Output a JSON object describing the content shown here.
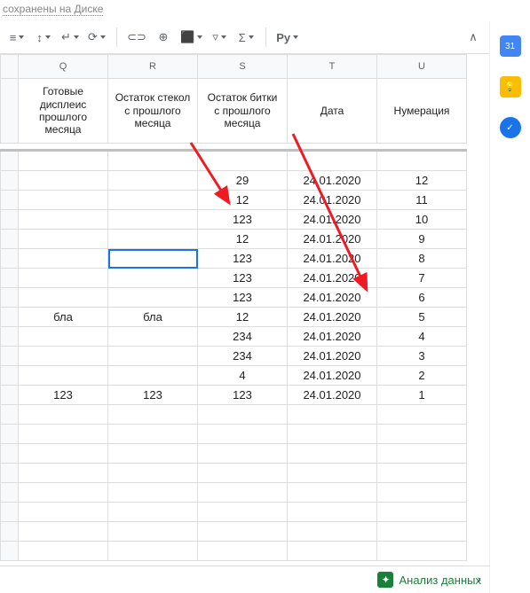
{
  "top_status": "сохранены на Диске",
  "toolbar": {
    "link": "⊂⊃",
    "comment": "⊕",
    "chart": "⬛",
    "filter": "▿",
    "sigma": "Σ",
    "py": "Py"
  },
  "side_rail": {
    "cal": "31",
    "keep": "",
    "tasks": "✓"
  },
  "columns": [
    {
      "id": "Q",
      "letter": "Q",
      "header": "Готовые дисплеис прошлого месяца"
    },
    {
      "id": "R",
      "letter": "R",
      "header": "Остаток стекол с прошлого месяца"
    },
    {
      "id": "S",
      "letter": "S",
      "header": "Остаток битки с прошлого месяца"
    },
    {
      "id": "T",
      "letter": "T",
      "header": "Дата"
    },
    {
      "id": "U",
      "letter": "U",
      "header": "Нумерация"
    }
  ],
  "rows": [
    {
      "Q": "",
      "R": "",
      "S": "29",
      "T": "24.01.2020",
      "U": "12"
    },
    {
      "Q": "",
      "R": "",
      "S": "12",
      "T": "24.01.2020",
      "U": "11"
    },
    {
      "Q": "",
      "R": "",
      "S": "123",
      "T": "24.01.2020",
      "U": "10"
    },
    {
      "Q": "",
      "R": "",
      "S": "12",
      "T": "24.01.2020",
      "U": "9"
    },
    {
      "Q": "",
      "R": "",
      "S": "123",
      "T": "24.01.2020",
      "U": "8"
    },
    {
      "Q": "",
      "R": "",
      "S": "123",
      "T": "24.01.2020",
      "U": "7"
    },
    {
      "Q": "",
      "R": "",
      "S": "123",
      "T": "24.01.2020",
      "U": "6"
    },
    {
      "Q": "бла",
      "R": "бла",
      "S": "12",
      "T": "24.01.2020",
      "U": "5"
    },
    {
      "Q": "",
      "R": "",
      "S": "234",
      "T": "24.01.2020",
      "U": "4"
    },
    {
      "Q": "",
      "R": "",
      "S": "234",
      "T": "24.01.2020",
      "U": "3"
    },
    {
      "Q": "",
      "R": "",
      "S": "4",
      "T": "24.01.2020",
      "U": "2"
    },
    {
      "Q": "123",
      "R": "123",
      "S": "123",
      "T": "24.01.2020",
      "U": "1"
    }
  ],
  "selected_cell": {
    "row": 4,
    "col": "R"
  },
  "bottom": {
    "analyze": "Анализ данных"
  },
  "chart_data": {
    "type": "table",
    "title": "",
    "columns": [
      "Готовые дисплеис прошлого месяца",
      "Остаток стекол с прошлого месяца",
      "Остаток битки с прошлого месяца",
      "Дата",
      "Нумерация"
    ],
    "annotations": [
      "Arrow to S column values",
      "Arrow to T column Дата values"
    ]
  }
}
